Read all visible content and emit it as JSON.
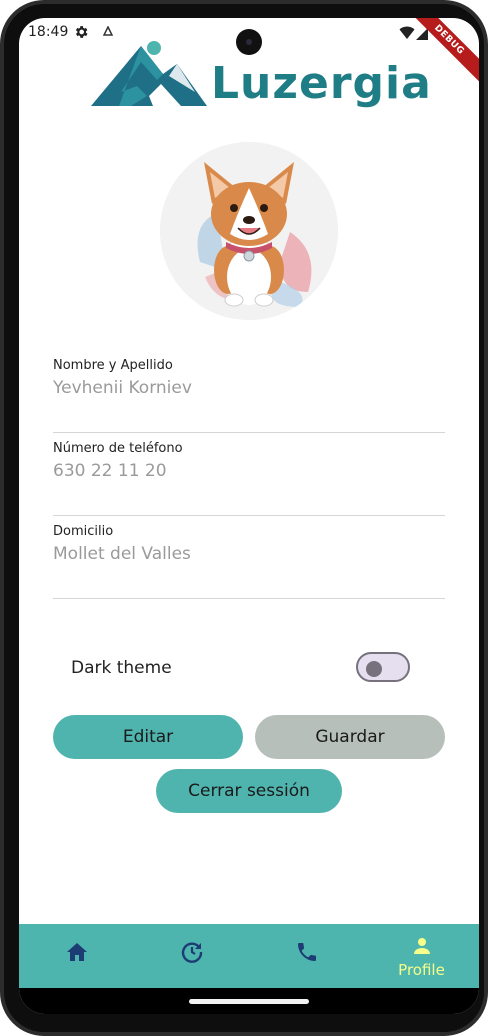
{
  "status_bar": {
    "time": "18:49",
    "debug_label": "DEBUG"
  },
  "logo": {
    "text": "Luzergia"
  },
  "profile": {
    "fields": [
      {
        "label": "Nombre y Apellido",
        "value": "Yevhenii Korniev"
      },
      {
        "label": "Número de teléfono",
        "value": "630 22 11 20"
      },
      {
        "label": "Domicilio",
        "value": "Mollet del Valles"
      }
    ]
  },
  "settings": {
    "dark_theme_label": "Dark theme",
    "dark_theme_on": false
  },
  "actions": {
    "edit_label": "Editar",
    "save_label": "Guardar",
    "logout_label": "Cerrar sessión"
  },
  "bottom_nav": {
    "items": [
      {
        "icon": "home-icon",
        "label": ""
      },
      {
        "icon": "history-icon",
        "label": ""
      },
      {
        "icon": "phone-icon",
        "label": ""
      },
      {
        "icon": "person-icon",
        "label": "Profile"
      }
    ],
    "active_index": 3
  },
  "colors": {
    "accent": "#4db5ae",
    "logo": "#1f7d86",
    "nav_active": "#f5ff8a",
    "nav_icon": "#1d3c73",
    "save_button": "#b7bfbb"
  }
}
